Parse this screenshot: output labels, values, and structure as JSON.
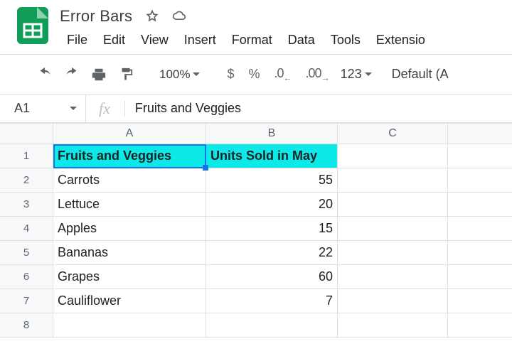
{
  "doc": {
    "title": "Error Bars"
  },
  "menu": {
    "file": "File",
    "edit": "Edit",
    "view": "View",
    "insert": "Insert",
    "format": "Format",
    "data": "Data",
    "tools": "Tools",
    "extensions": "Extensio"
  },
  "toolbar": {
    "zoom": "100%",
    "currency": "$",
    "percent": "%",
    "dec_dec": ".0",
    "inc_dec": ".00",
    "more_formats": "123",
    "font": "Default (A"
  },
  "formula": {
    "namebox": "A1",
    "value": "Fruits and Veggies"
  },
  "columns": {
    "A": "A",
    "B": "B",
    "C": "C",
    "D": ""
  },
  "rows": {
    "1": {
      "A": "Fruits and Veggies",
      "B": "Units Sold in May",
      "C": "",
      "D": ""
    },
    "2": {
      "A": "Carrots",
      "B": "55",
      "C": "",
      "D": ""
    },
    "3": {
      "A": "Lettuce",
      "B": "20",
      "C": "",
      "D": ""
    },
    "4": {
      "A": "Apples",
      "B": "15",
      "C": "",
      "D": ""
    },
    "5": {
      "A": "Bananas",
      "B": "22",
      "C": "",
      "D": ""
    },
    "6": {
      "A": "Grapes",
      "B": "60",
      "C": "",
      "D": ""
    },
    "7": {
      "A": "Cauliflower",
      "B": "7",
      "C": "",
      "D": ""
    },
    "8": {
      "A": "",
      "B": "",
      "C": "",
      "D": ""
    }
  }
}
